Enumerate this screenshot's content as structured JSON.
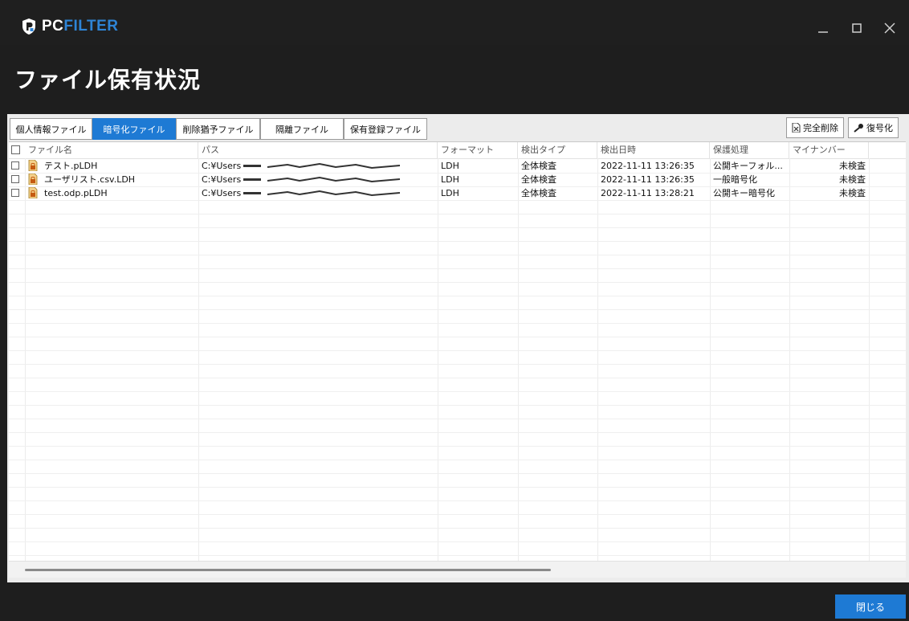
{
  "app": {
    "logo_pc": "PC",
    "logo_filter": "FILTER",
    "page_title": "ファイル保有状況"
  },
  "window_controls": {
    "minimize": "‗",
    "maximize": "☐",
    "close": "✕"
  },
  "tabs": [
    {
      "label": "個人情報ファイル",
      "active": false
    },
    {
      "label": "暗号化ファイル",
      "active": true
    },
    {
      "label": "削除猶予ファイル",
      "active": false
    },
    {
      "label": "隔離ファイル",
      "active": false
    },
    {
      "label": "保有登録ファイル",
      "active": false
    }
  ],
  "actions": {
    "delete_label": "完全削除",
    "decrypt_label": "復号化"
  },
  "table": {
    "columns": [
      "ファイル名",
      "パス",
      "フォーマット",
      "検出タイプ",
      "検出日時",
      "保護処理",
      "マイナンバー"
    ],
    "rows": [
      {
        "name": "テスト.pLDH",
        "path_prefix": "C:¥Users",
        "format": "LDH",
        "type": "全体検査",
        "datetime": "2022-11-11 13:26:35",
        "protection": "公開キーフォル...",
        "mynumber": "未検査"
      },
      {
        "name": "ユーザリスト.csv.LDH",
        "path_prefix": "C:¥Users",
        "format": "LDH",
        "type": "全体検査",
        "datetime": "2022-11-11 13:26:35",
        "protection": "一般暗号化",
        "mynumber": "未検査"
      },
      {
        "name": "test.odp.pLDH",
        "path_prefix": "C:¥Users",
        "format": "LDH",
        "type": "全体検査",
        "datetime": "2022-11-11 13:28:21",
        "protection": "公開キー暗号化",
        "mynumber": "未検査"
      }
    ]
  },
  "footer": {
    "close_label": "閉じる"
  },
  "colors": {
    "accent": "#1e7ad4",
    "background": "#1e1e1e",
    "logo_blue": "#2e84d6"
  },
  "icons": [
    "pcfilter-shield-icon",
    "minimize-icon",
    "maximize-icon",
    "close-icon",
    "document-delete-icon",
    "key-icon",
    "encrypted-file-icon"
  ]
}
